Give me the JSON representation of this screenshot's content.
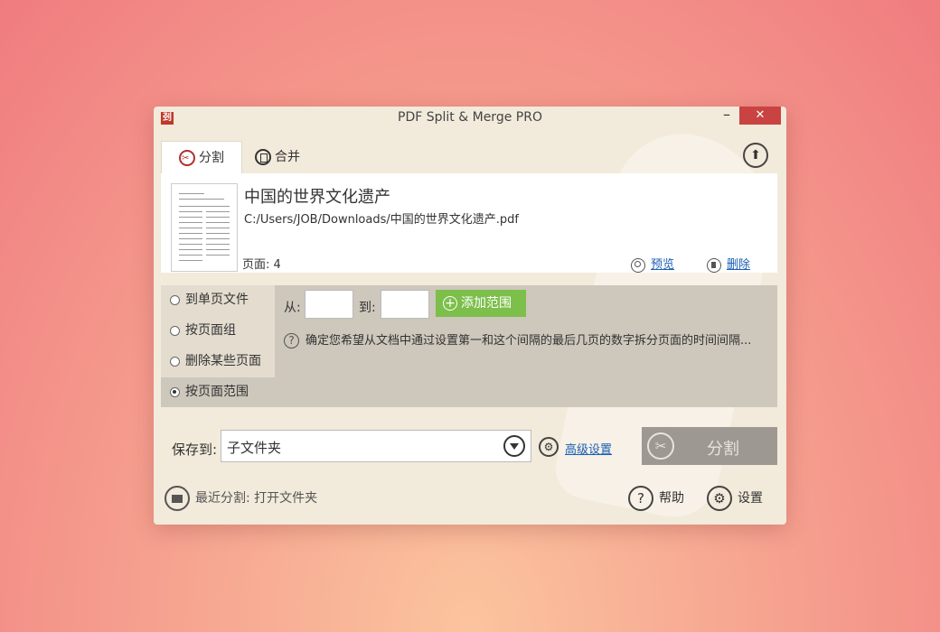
{
  "window": {
    "title": "PDF Split & Merge PRO",
    "logo": "刭",
    "minimize_glyph": "–",
    "close_glyph": "✕"
  },
  "tabs": [
    {
      "label": "分割",
      "icon": "scissors-icon",
      "active": true
    },
    {
      "label": "合并",
      "icon": "document-icon",
      "active": false
    }
  ],
  "file": {
    "title": "中国的世界文化遗产",
    "path": "C:/Users/JOB/Downloads/中国的世界文化遗产.pdf",
    "pages": "页面: 4",
    "preview_label": "预览",
    "delete_label": "删除"
  },
  "modes": [
    {
      "label": "到单页文件",
      "selected": false
    },
    {
      "label": "按页面组",
      "selected": false
    },
    {
      "label": "删除某些页面",
      "selected": false
    },
    {
      "label": "按页面范围",
      "selected": true
    }
  ],
  "range": {
    "from_label": "从:",
    "to_label": "到:",
    "from_value": "",
    "to_value": "",
    "add_label": "添加范围",
    "hint": "确定您希望从文档中通过设置第一和这个间隔的最后几页的数字拆分页面的时间间隔..."
  },
  "save": {
    "label": "保存到:",
    "value": "子文件夹",
    "advanced_label": "高级设置",
    "split_label": "分割"
  },
  "footer": {
    "recent_label": "最近分割: 打开文件夹",
    "help_label": "帮助",
    "settings_label": "设置"
  },
  "colors": {
    "close_button": "#c94342",
    "add_range_button": "#7cbf4b",
    "split_button": "#9d9891",
    "link": "#1a5fb4"
  }
}
